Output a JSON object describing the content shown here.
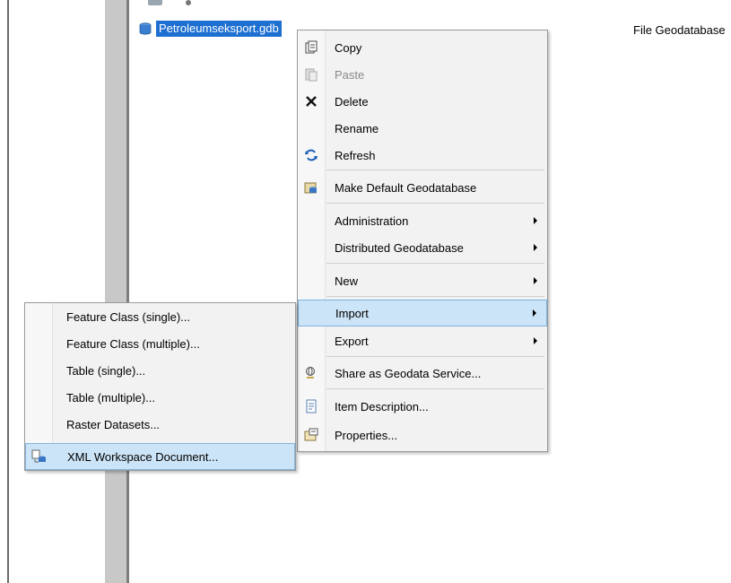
{
  "tree": {
    "selected_node": "Petroleumseksport.gdb",
    "type_column": "File Geodatabase"
  },
  "context_menu": {
    "items": [
      {
        "label": "Copy",
        "icon": "copy-icon"
      },
      {
        "label": "Paste",
        "icon": "paste-icon",
        "disabled": true
      },
      {
        "label": "Delete",
        "icon": "delete-icon"
      },
      {
        "label": "Rename"
      },
      {
        "label": "Refresh",
        "icon": "refresh-icon"
      },
      {
        "label": "Make Default Geodatabase",
        "icon": "make-default-icon"
      },
      {
        "label": "Administration",
        "submenu": true
      },
      {
        "label": "Distributed Geodatabase",
        "submenu": true
      },
      {
        "label": "New",
        "submenu": true
      },
      {
        "label": "Import",
        "submenu": true,
        "highlighted": true
      },
      {
        "label": "Export",
        "submenu": true
      },
      {
        "label": "Share as Geodata Service...",
        "icon": "share-service-icon"
      },
      {
        "label": "Item Description...",
        "icon": "item-description-icon"
      },
      {
        "label": "Properties...",
        "icon": "properties-icon"
      }
    ]
  },
  "import_submenu": {
    "items": [
      {
        "label": "Feature Class (single)..."
      },
      {
        "label": "Feature Class (multiple)..."
      },
      {
        "label": "Table (single)..."
      },
      {
        "label": "Table (multiple)..."
      },
      {
        "label": "Raster Datasets..."
      },
      {
        "label": "XML Workspace Document...",
        "icon": "xml-workspace-icon",
        "highlighted": true
      }
    ]
  },
  "colors": {
    "selection": "#1d6fd1",
    "menu_background": "#f2f2f2",
    "menu_highlight": "#cce4f7",
    "menu_highlight_border": "#7fb3dd"
  }
}
